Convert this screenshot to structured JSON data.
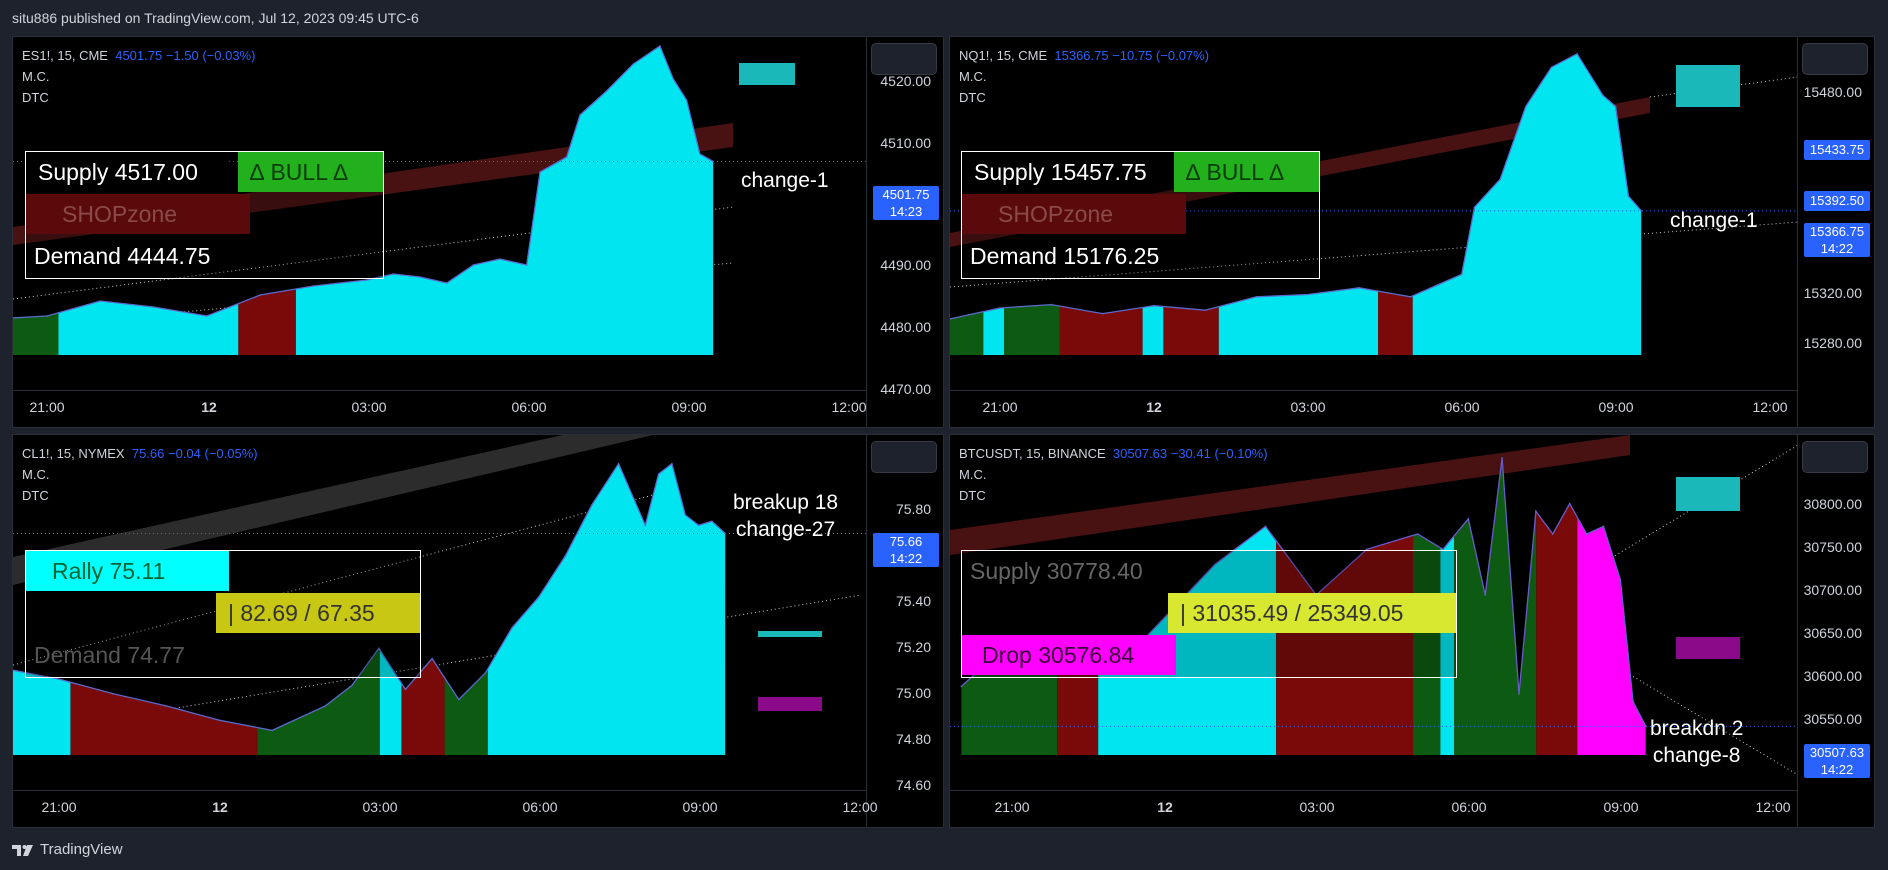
{
  "header": {
    "text": "situ886 published on TradingView.com, Jul 12, 2023 09:45 UTC-6"
  },
  "footer": {
    "logo_text": "TradingView"
  },
  "panels": [
    {
      "symbol": "ES1!, 15, CME",
      "quote": "4501.75  −1.50 (−0.03%)",
      "line2": "M.C.",
      "line3": "DTC",
      "price_tag": "4501.75",
      "price_tag_time": "14:23",
      "note": "change-1",
      "box": {
        "r1_label": "Supply  4517.00",
        "r1_badge": "∆  BULL  ∆",
        "r2_label": "SHOPzone",
        "r3_label": "Demand  4444.75"
      },
      "colors": {
        "badge_bg": "#22b01c",
        "badge_fg": "#0b3d0b"
      }
    },
    {
      "symbol": "NQ1!, 15, CME",
      "quote": "15366.75  −10.75 (−0.07%)",
      "line2": "M.C.",
      "line3": "DTC",
      "price_tag": "15366.75",
      "price_tag_time": "14:22",
      "extra_tags": [
        "15433.75",
        "15392.50"
      ],
      "note": "change-1",
      "box": {
        "r1_label": "Supply  15457.75",
        "r1_badge": "∆  BULL  ∆",
        "r2_label": "SHOPzone",
        "r3_label": "Demand  15176.25"
      }
    },
    {
      "symbol": "CL1!, 15, NYMEX",
      "quote": "75.66  −0.04 (−0.05%)",
      "line2": "M.C.",
      "line3": "DTC",
      "price_tag": "75.66",
      "price_tag_time": "14:22",
      "note_line1": "breakup 18",
      "note_line2": "change-27",
      "box": {
        "r1_label": "Rally  75.11",
        "r2_badge": "|   82.69 / 67.35",
        "r3_label": "Demand  74.77"
      }
    },
    {
      "symbol": "BTCUSDT, 15, BINANCE",
      "quote": "30507.63  −30.41 (−0.10%)",
      "line2": "M.C.",
      "line3": "DTC",
      "price_tag": "30507.63",
      "price_tag_time": "14:22",
      "note_line1": "breakdn 2",
      "note_line2": "change-8",
      "box": {
        "r1_label": "Supply  30778.40",
        "r2_badge": "|   31035.49 / 25349.05",
        "r3_label": "Drop  30576.84"
      }
    }
  ],
  "colors": {
    "area": "#00e5f0",
    "bear": "#7a0a0a",
    "bull": "#0d5a12",
    "magenta": "#ff00ff",
    "yellow": "#dcdc14"
  },
  "chart_data": [
    {
      "type": "area",
      "title": "ES1!, 15, CME",
      "x_ticks": [
        "21:00",
        "12",
        "03:00",
        "06:00",
        "09:00",
        "12:00"
      ],
      "y_ticks": [
        4520.0,
        4510.0,
        4490.0,
        4480.0,
        4470.0
      ],
      "ylim": [
        4469.5,
        4522.5
      ],
      "x": [
        "20:00",
        "21:00",
        "22:00",
        "23:00",
        "00:00",
        "01:00",
        "02:00",
        "03:00",
        "03:30",
        "04:00",
        "04:30",
        "05:00",
        "05:30",
        "06:00",
        "06:15",
        "06:45",
        "07:00",
        "07:30",
        "08:00",
        "08:30",
        "08:45",
        "09:00",
        "09:15",
        "09:30"
      ],
      "values": [
        4475.5,
        4476.0,
        4478.5,
        4477.5,
        4476.0,
        4479.5,
        4481.0,
        4482.0,
        4483.0,
        4482.5,
        4481.5,
        4484.5,
        4485.5,
        4484.5,
        4500.0,
        4502.5,
        4509.5,
        4513.5,
        4518.0,
        4521.0,
        4515.5,
        4512.0,
        4503.0,
        4501.75
      ]
    },
    {
      "type": "area",
      "title": "NQ1!, 15, CME",
      "x_ticks": [
        "21:00",
        "12",
        "03:00",
        "06:00",
        "09:00",
        "12:00"
      ],
      "y_ticks": [
        15480.0,
        15433.75,
        15392.5,
        15366.75,
        15320.0,
        15280.0
      ],
      "ylim": [
        15238,
        15522
      ],
      "x": [
        "20:00",
        "21:00",
        "22:00",
        "23:00",
        "00:00",
        "01:00",
        "02:00",
        "03:00",
        "04:00",
        "05:00",
        "05:30",
        "06:00",
        "06:15",
        "06:45",
        "07:15",
        "07:45",
        "08:15",
        "08:45",
        "09:00",
        "09:15",
        "09:30"
      ],
      "values": [
        15270,
        15280,
        15283,
        15275,
        15282,
        15278,
        15290,
        15292,
        15298,
        15290,
        15300,
        15310,
        15370,
        15395,
        15460,
        15495,
        15507,
        15470,
        15460,
        15380,
        15366.75
      ]
    },
    {
      "type": "area",
      "title": "CL1!, 15, NYMEX",
      "x_ticks": [
        "21:00",
        "12",
        "03:00",
        "06:00",
        "09:00",
        "12:00"
      ],
      "y_ticks": [
        75.8,
        75.66,
        75.4,
        75.2,
        75.0,
        74.8,
        74.6
      ],
      "ylim": [
        74.58,
        76.14
      ],
      "x": [
        "20:00",
        "21:00",
        "22:00",
        "23:00",
        "00:00",
        "01:00",
        "02:00",
        "02:30",
        "03:00",
        "03:30",
        "04:00",
        "04:30",
        "05:00",
        "05:30",
        "06:00",
        "06:30",
        "07:00",
        "07:30",
        "08:00",
        "08:15",
        "08:30",
        "08:45",
        "09:00",
        "09:15",
        "09:30"
      ],
      "values": [
        75.0,
        74.95,
        74.88,
        74.82,
        74.75,
        74.7,
        74.82,
        74.92,
        75.1,
        74.9,
        75.05,
        74.85,
        74.98,
        75.2,
        75.35,
        75.55,
        75.8,
        76.0,
        75.7,
        75.95,
        76.0,
        75.75,
        75.7,
        75.72,
        75.66
      ]
    },
    {
      "type": "area",
      "title": "BTCUSDT, 15, BINANCE",
      "x_ticks": [
        "21:00",
        "12",
        "03:00",
        "06:00",
        "09:00",
        "12:00"
      ],
      "y_ticks": [
        30800.0,
        30750.0,
        30700.0,
        30650.0,
        30600.0,
        30550.0,
        30507.63
      ],
      "ylim": [
        30470,
        30890
      ],
      "x": [
        "20:00",
        "21:00",
        "22:00",
        "23:00",
        "00:00",
        "01:00",
        "02:00",
        "03:00",
        "04:00",
        "05:00",
        "05:30",
        "06:00",
        "06:20",
        "06:40",
        "07:00",
        "07:20",
        "07:40",
        "08:00",
        "08:20",
        "08:40",
        "09:00",
        "09:15",
        "09:30"
      ],
      "values": [
        30560,
        30620,
        30590,
        30580,
        30650,
        30720,
        30770,
        30680,
        30740,
        30760,
        30740,
        30780,
        30680,
        30860,
        30550,
        30790,
        30760,
        30800,
        30760,
        30770,
        30700,
        30540,
        30507.63
      ]
    }
  ]
}
